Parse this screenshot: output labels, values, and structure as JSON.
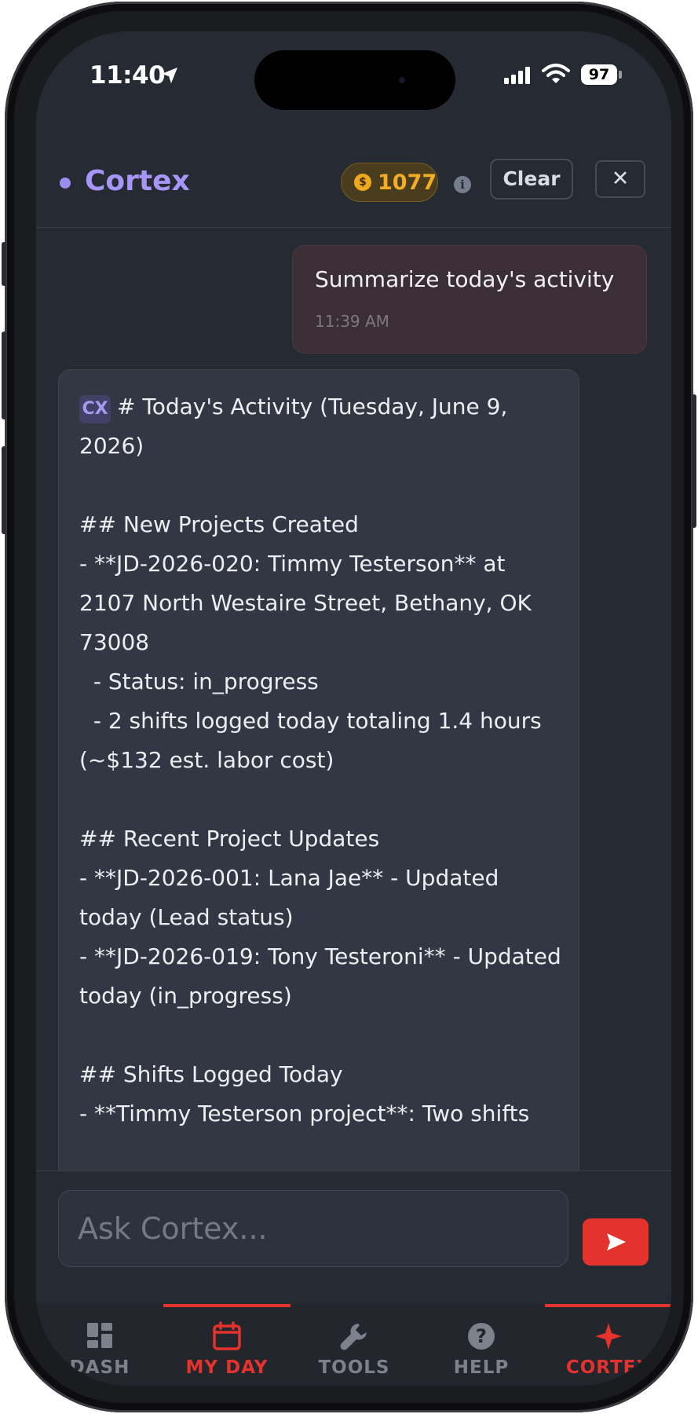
{
  "status_bar": {
    "time": "11:40",
    "battery": "97"
  },
  "header": {
    "brand": "Cortex",
    "credits": "1077",
    "coin_symbol": "$",
    "clear_label": "Clear",
    "close_label": "✕"
  },
  "messages": {
    "user": {
      "text": "Summarize today's activity",
      "time": "11:39 AM"
    },
    "assistant": {
      "badge": "CX",
      "text": "# Today's Activity (Tuesday, June 9, 2026)\n\n## New Projects Created\n- **JD-2026-020: Timmy Testerson** at 2107 North Westaire Street, Bethany, OK 73008\n  - Status: in_progress\n  - 2 shifts logged today totaling 1.4 hours (~$132 est. labor cost)\n\n## Recent Project Updates\n- **JD-2026-001: Lana Jae** - Updated today (Lead status)\n- **JD-2026-019: Tony Testeroni** - Updated today (in_progress)\n\n## Shifts Logged Today\n- **Timmy Testerson project**: Two shifts"
    }
  },
  "input": {
    "placeholder": "Ask Cortex..."
  },
  "tabs": [
    {
      "label": "DASH",
      "icon": "dashboard-icon"
    },
    {
      "label": "MY DAY",
      "icon": "calendar-icon"
    },
    {
      "label": "TOOLS",
      "icon": "wrench-icon"
    },
    {
      "label": "HELP",
      "icon": "help-circle-icon"
    },
    {
      "label": "CORTEX",
      "icon": "sparkle-icon"
    }
  ],
  "colors": {
    "accent": "#e4322c",
    "brand": "#a796f7",
    "credits": "#f2ac25",
    "background": "#262a33"
  }
}
